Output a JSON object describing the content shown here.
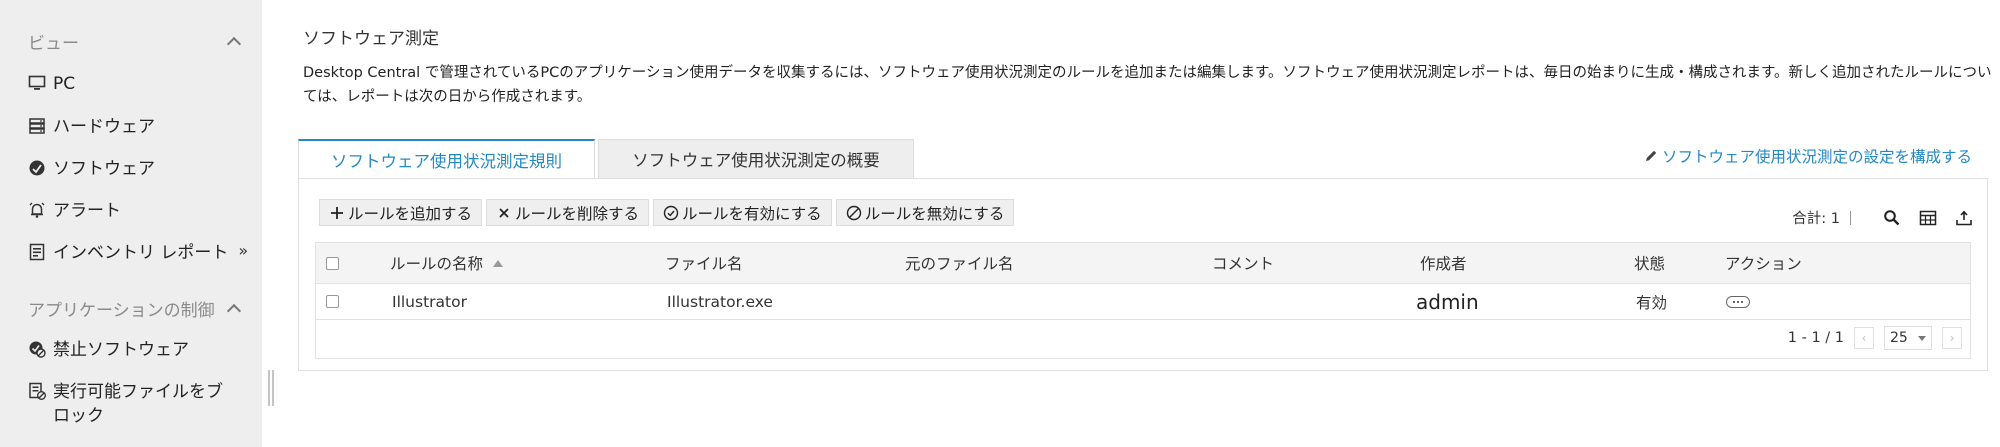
{
  "sidebar": {
    "view_section": "ビュー",
    "view_items": [
      {
        "label": "PC",
        "icon": "monitor-icon"
      },
      {
        "label": "ハードウェア",
        "icon": "hardware-icon"
      },
      {
        "label": "ソフトウェア",
        "icon": "software-icon"
      },
      {
        "label": "アラート",
        "icon": "alert-bell-icon"
      },
      {
        "label": "インベントリ レポート",
        "icon": "report-icon",
        "more": "»"
      }
    ],
    "appctrl_section": "アプリケーションの制御",
    "appctrl_items": [
      {
        "label": "禁止ソフトウェア",
        "icon": "prohibited-software-icon"
      },
      {
        "label": "実行可能ファイルをブロック",
        "icon": "block-executable-icon"
      }
    ]
  },
  "main": {
    "title": "ソフトウェア測定",
    "description": "Desktop Central で管理されているPCのアプリケーション使用データを収集するには、ソフトウェア使用状況測定のルールを追加または編集します。ソフトウェア使用状況測定レポートは、毎日の始まりに生成・構成されます。新しく追加されたルールについては、レポートは次の日から作成されます。",
    "tabs": [
      {
        "label": "ソフトウェア使用状況測定規則",
        "active": true
      },
      {
        "label": "ソフトウェア使用状況測定の概要",
        "active": false
      }
    ],
    "config_link": "ソフトウェア使用状況測定の設定を構成する",
    "toolbar": {
      "add": "ルールを追加する",
      "delete": "ルールを削除する",
      "enable": "ルールを有効にする",
      "disable": "ルールを無効にする",
      "total": "合計: 1"
    },
    "table": {
      "columns": {
        "name": "ルールの名称",
        "file": "ファイル名",
        "original": "元のファイル名",
        "comment": "コメント",
        "author": "作成者",
        "status": "状態",
        "action": "アクション"
      },
      "rows": [
        {
          "name": "Illustrator",
          "file": "Illustrator.exe",
          "original": "",
          "comment": "",
          "author": "admin",
          "status": "有効"
        }
      ]
    },
    "pager": {
      "range": "1 - 1 / 1",
      "per_page": "25"
    }
  },
  "colors": {
    "accent": "#2389c5",
    "sidebar_bg": "#eeeeee"
  }
}
